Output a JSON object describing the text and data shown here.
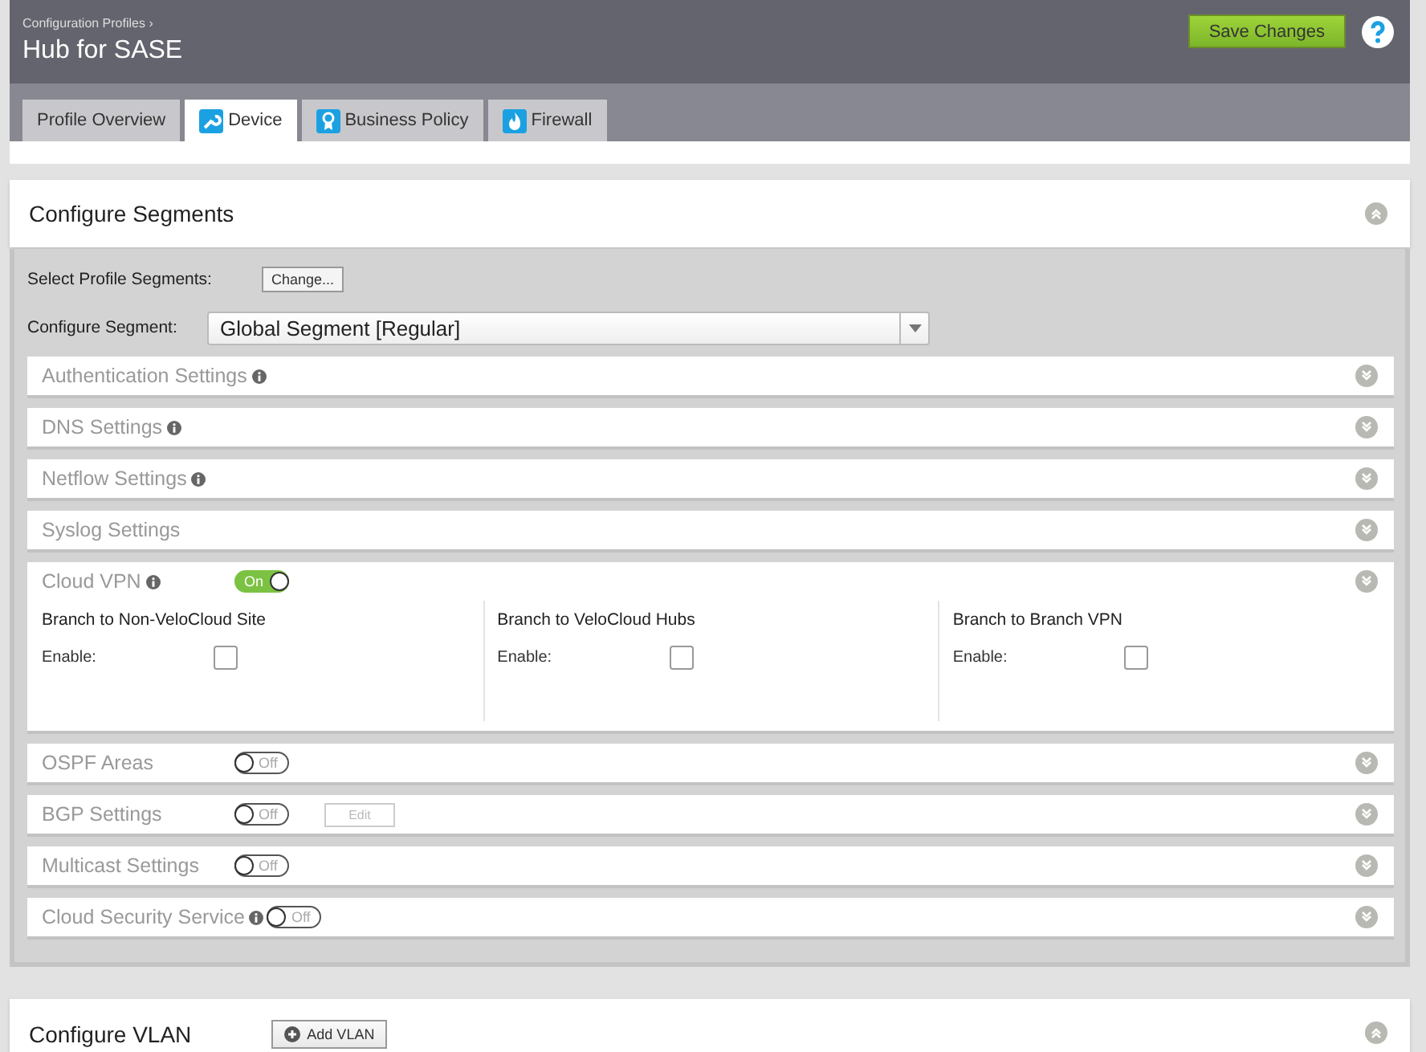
{
  "header": {
    "breadcrumb": "Configuration Profiles ›",
    "title": "Hub for SASE",
    "save_button": "Save Changes"
  },
  "tabs": [
    {
      "label": "Profile Overview",
      "selected": false
    },
    {
      "label": "Device",
      "selected": true
    },
    {
      "label": "Business Policy",
      "selected": false
    },
    {
      "label": "Firewall",
      "selected": false
    }
  ],
  "segments_card": {
    "title": "Configure Segments",
    "select_label": "Select Profile Segments:",
    "change_button": "Change...",
    "segment_label": "Configure Segment:",
    "segment_value": "Global Segment [Regular]"
  },
  "sections": [
    {
      "kind": "plain",
      "title": "Authentication Settings",
      "info": true
    },
    {
      "kind": "plain",
      "title": "DNS Settings",
      "info": true
    },
    {
      "kind": "plain",
      "title": "Netflow Settings",
      "info": true
    },
    {
      "kind": "plain",
      "title": "Syslog Settings"
    },
    {
      "kind": "toggle",
      "title": "Cloud VPN",
      "info": true,
      "on": true,
      "toggle_label": "On",
      "expanded": true,
      "columns": [
        {
          "heading": "Branch to Non-VeloCloud Site",
          "enable_label": "Enable:",
          "checked": false
        },
        {
          "heading": "Branch to VeloCloud Hubs",
          "enable_label": "Enable:",
          "checked": false
        },
        {
          "heading": "Branch to Branch VPN",
          "enable_label": "Enable:",
          "checked": false
        }
      ]
    },
    {
      "kind": "toggle",
      "title": "OSPF Areas",
      "on": false,
      "toggle_label": "Off"
    },
    {
      "kind": "toggle",
      "title": "BGP Settings",
      "on": false,
      "toggle_label": "Off",
      "button": "Edit"
    },
    {
      "kind": "toggle",
      "title": "Multicast Settings",
      "on": false,
      "toggle_label": "Off"
    },
    {
      "kind": "toggle",
      "title": "Cloud Security Service",
      "info": true,
      "on": false,
      "toggle_label": "Off"
    }
  ],
  "vlan_card": {
    "title": "Configure VLAN",
    "add_button": "Add VLAN"
  }
}
